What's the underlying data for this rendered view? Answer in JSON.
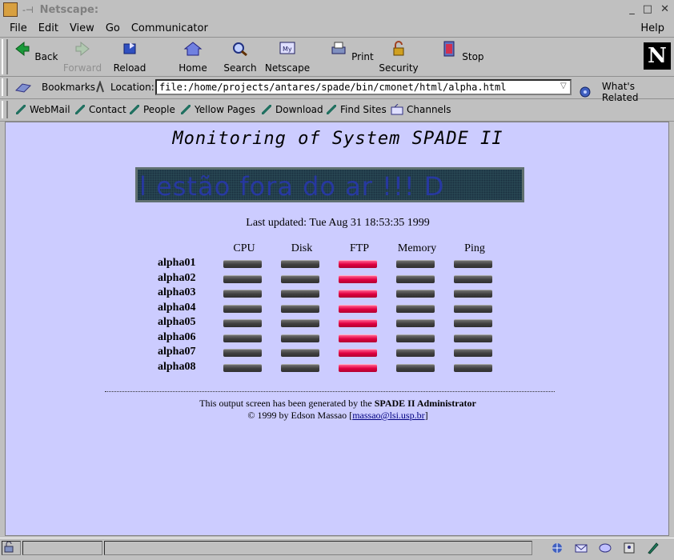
{
  "window": {
    "title": "Netscape:",
    "pin": "-⊣"
  },
  "menu": {
    "items": [
      "File",
      "Edit",
      "View",
      "Go",
      "Communicator"
    ],
    "help": "Help"
  },
  "toolbar": {
    "back": "Back",
    "forward": "Forward",
    "reload": "Reload",
    "home": "Home",
    "search": "Search",
    "netscape": "Netscape",
    "print": "Print",
    "security": "Security",
    "stop": "Stop",
    "logo": "N"
  },
  "location": {
    "bookmarks": "Bookmarks",
    "label": "Location:",
    "url": "file:/home/projects/antares/spade/bin/cmonet/html/alpha.html",
    "whats_related": "What's Related"
  },
  "personal": {
    "items": [
      "WebMail",
      "Contact",
      "People",
      "Yellow Pages",
      "Download",
      "Find Sites",
      "Channels"
    ]
  },
  "page": {
    "title": "Monitoring of System SPADE II",
    "led_text": "l estão fora do ar !!! D",
    "last_updated": "Last updated: Tue Aug 31 18:53:35 1999",
    "columns": [
      "CPU",
      "Disk",
      "FTP",
      "Memory",
      "Ping"
    ],
    "hosts": [
      {
        "name": "alpha01",
        "status": [
          "ok",
          "ok",
          "bad",
          "ok",
          "ok"
        ]
      },
      {
        "name": "alpha02",
        "status": [
          "ok",
          "ok",
          "bad",
          "ok",
          "ok"
        ]
      },
      {
        "name": "alpha03",
        "status": [
          "ok",
          "ok",
          "bad",
          "ok",
          "ok"
        ]
      },
      {
        "name": "alpha04",
        "status": [
          "ok",
          "ok",
          "bad",
          "ok",
          "ok"
        ]
      },
      {
        "name": "alpha05",
        "status": [
          "ok",
          "ok",
          "bad",
          "ok",
          "ok"
        ]
      },
      {
        "name": "alpha06",
        "status": [
          "ok",
          "ok",
          "bad",
          "ok",
          "ok"
        ]
      },
      {
        "name": "alpha07",
        "status": [
          "ok",
          "ok",
          "bad",
          "ok",
          "ok"
        ]
      },
      {
        "name": "alpha08",
        "status": [
          "ok",
          "ok",
          "bad",
          "ok",
          "ok"
        ]
      }
    ],
    "footer": {
      "generated_prefix": "This output screen has been generated by the",
      "generated_bold": "SPADE II Administrator",
      "copyright": "© 1999 by Edson Massao",
      "email": "massao@lsi.usp.br"
    }
  },
  "colors": {
    "page_bg": "#ccccff",
    "status_ok": "#404040",
    "status_bad": "#e00040",
    "chrome": "#c0c0c0"
  }
}
